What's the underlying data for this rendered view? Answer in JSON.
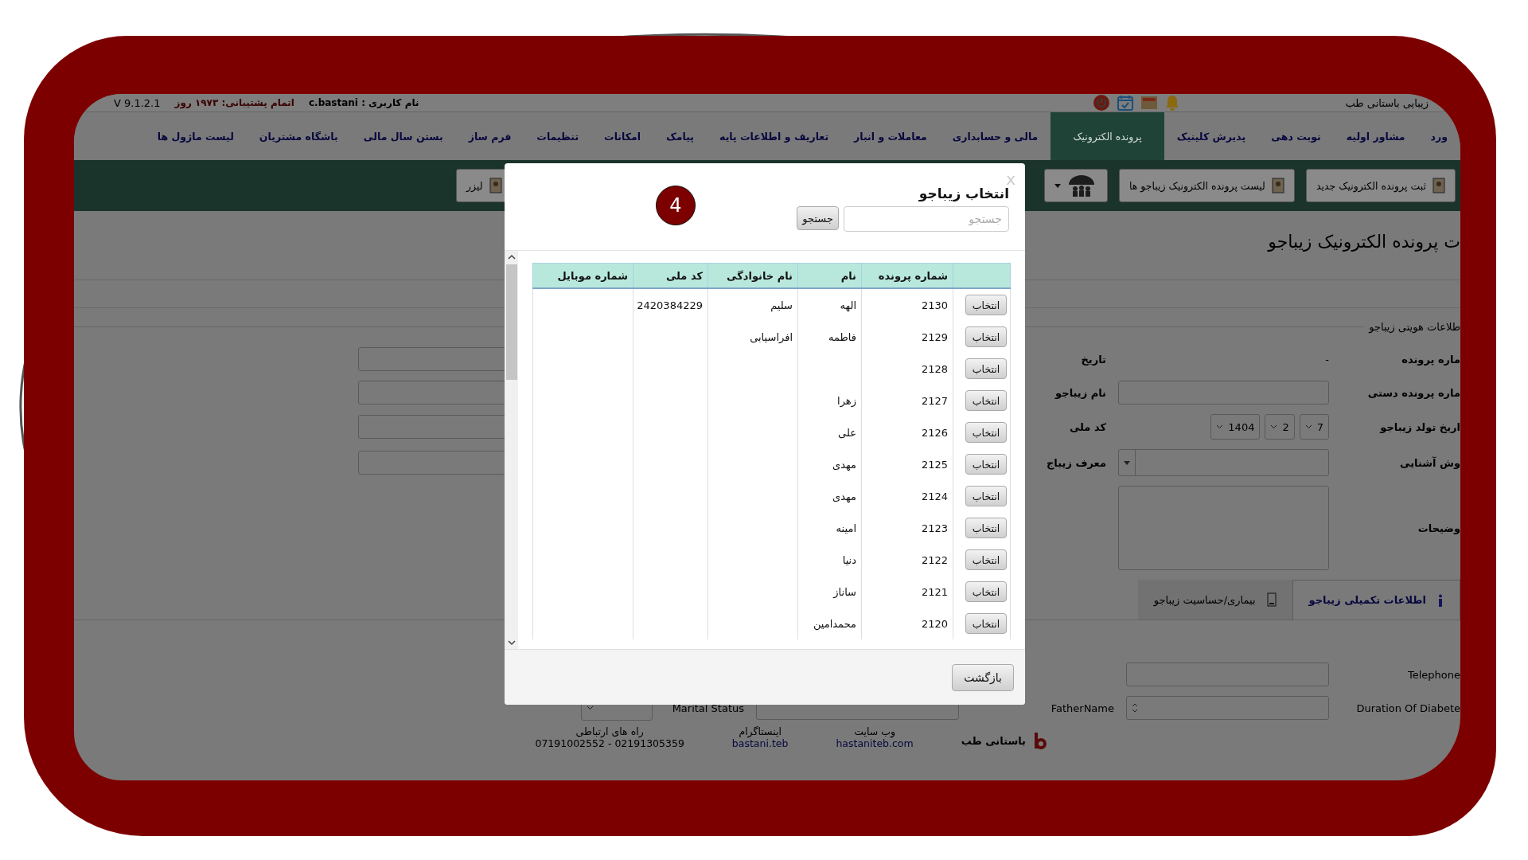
{
  "top_bar": {
    "clinic": "زیبایی باستانی طب",
    "user": "نام کاربری : c.bastani",
    "support": "اتمام پشتیبانی: ۱۹۷۳ روز",
    "version": "V 9.1.2.1"
  },
  "nav": [
    {
      "label": "ورد",
      "selected": false
    },
    {
      "label": "مشاور اولیه",
      "selected": false
    },
    {
      "label": "نوبت دهی",
      "selected": false
    },
    {
      "label": "پذیرش کلینیک",
      "selected": false
    },
    {
      "label": "پرونده الکترونیک",
      "selected": true
    },
    {
      "label": "مالی و حسابداری",
      "selected": false
    },
    {
      "label": "معاملات و انبار",
      "selected": false
    },
    {
      "label": "تعاریف و اطلاعات پایه",
      "selected": false
    },
    {
      "label": "پیامک",
      "selected": false
    },
    {
      "label": "امکانات",
      "selected": false
    },
    {
      "label": "تنظیمات",
      "selected": false
    },
    {
      "label": "فرم ساز",
      "selected": false
    },
    {
      "label": "بستن سال مالی",
      "selected": false
    },
    {
      "label": "باشگاه مشتریان",
      "selected": false
    },
    {
      "label": "لیست ماژول ها",
      "selected": false
    }
  ],
  "toolbar": [
    {
      "kind": "button",
      "label": "ثبت پرونده الکترونیک جدید"
    },
    {
      "kind": "button",
      "label": "لیست پرونده الکترونیک زیباجو ها"
    },
    {
      "kind": "menu"
    },
    {
      "kind": "button",
      "label": "لیزر"
    }
  ],
  "page": {
    "title": "ت پرونده الکترونیک زیباجو",
    "section": "طلاعات هویتی زیباجو",
    "rows": [
      {
        "kind": "value",
        "label": "ماره پرونده",
        "value": "-",
        "label2": "تاریخ"
      },
      {
        "kind": "input",
        "label": "ماره پرونده دستی",
        "label2": "نام زیباجو"
      },
      {
        "kind": "date",
        "label": "اریخ تولد زیباجو",
        "date": [
          "7",
          "2",
          "1404"
        ],
        "label2": "کد ملی"
      },
      {
        "kind": "select",
        "label": "وش آشنایی",
        "label2": "معرف زیباج"
      },
      {
        "kind": "textarea",
        "label": "وضیحات"
      }
    ],
    "tabs": [
      {
        "label": "اطلاعات تکمیلی زیباجو",
        "selected": true
      },
      {
        "label": "بیماری/حساسیت زیباجو",
        "selected": false
      }
    ],
    "extra_rows": [
      {
        "label": "Telephone"
      },
      {
        "label": "Duration Of Diabete",
        "label2": "FatherName",
        "label3": "Marital Status"
      }
    ]
  },
  "footer": {
    "brand": "باستانی طب",
    "links": [
      {
        "title": "وب سایت",
        "value": "hastaniteb.com"
      },
      {
        "title": "اینستاگرام",
        "value": "bastani.teb"
      },
      {
        "title": "راه های ارتباطی",
        "value": "07191002552 - 02191305359"
      }
    ]
  },
  "step_badge": "4",
  "dialog": {
    "title": "انتخاب زیباجو",
    "close": "x",
    "search": {
      "placeholder": "جستجو"
    },
    "search_button": "جستجو",
    "columns": [
      "شماره پرونده",
      "نام",
      "نام خانوادگی",
      "کد ملی",
      "شماره موبایل"
    ],
    "rows": [
      {
        "file": "2130",
        "name": "الهه",
        "family": "سلیم",
        "national_id": "2420384229",
        "action": "انتخاب"
      },
      {
        "file": "2129",
        "name": "فاطمه",
        "family": "افراسیابی",
        "action": "انتخاب"
      },
      {
        "file": "2128",
        "action": "انتخاب"
      },
      {
        "file": "2127",
        "name": "زهرا",
        "action": "انتخاب"
      },
      {
        "file": "2126",
        "name": "علی",
        "action": "انتخاب"
      },
      {
        "file": "2125",
        "name": "مهدی",
        "action": "انتخاب"
      },
      {
        "file": "2124",
        "name": "مهدی",
        "action": "انتخاب"
      },
      {
        "file": "2123",
        "name": "امینه",
        "action": "انتخاب"
      },
      {
        "file": "2122",
        "name": "دنیا",
        "action": "انتخاب"
      },
      {
        "file": "2121",
        "name": "ساناز",
        "action": "انتخاب"
      },
      {
        "file": "2120",
        "name": "محمدامین",
        "action": "انتخاب"
      }
    ],
    "back_button": "بازگشت"
  }
}
